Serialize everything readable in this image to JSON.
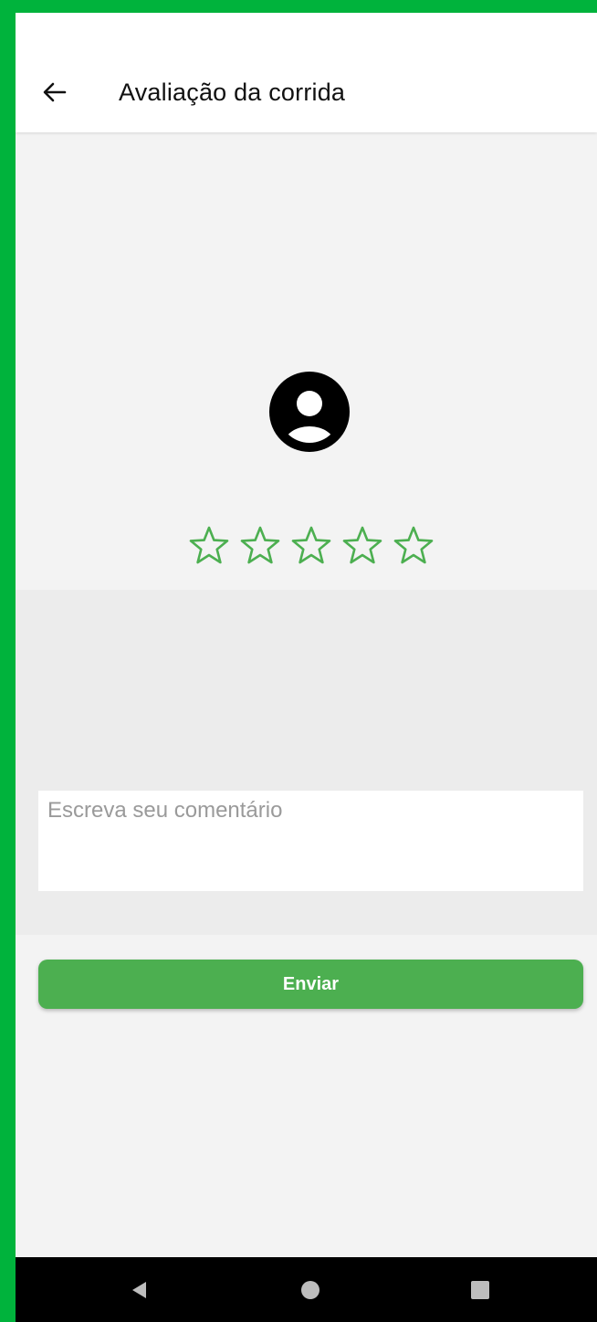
{
  "header": {
    "title": "Avaliação da corrida",
    "back_icon": "arrow-left-icon"
  },
  "profile": {
    "avatar_icon": "user-circle-icon"
  },
  "rating": {
    "value": 0,
    "max": 5,
    "star_color": "#4caf50",
    "star_icon": "star-outline-icon"
  },
  "comment": {
    "value": "",
    "placeholder": "Escreva seu comentário"
  },
  "submit": {
    "label": "Enviar",
    "color": "#4caf50"
  },
  "system_nav": {
    "back_icon": "triangle-back-icon",
    "home_icon": "circle-home-icon",
    "recents_icon": "square-recents-icon"
  },
  "colors": {
    "frame_border": "#00b33c",
    "background": "#f3f3f3"
  }
}
